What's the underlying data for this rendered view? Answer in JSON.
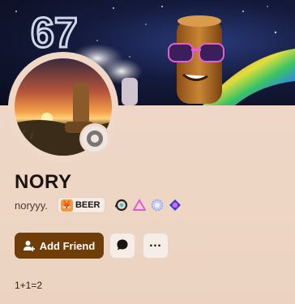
{
  "profile": {
    "display_name": "NORY",
    "username": "noryyy.",
    "bio": "1+1=2",
    "clan_tag": "BEER",
    "status": "offline"
  },
  "banner": {
    "art_text": "67"
  },
  "badges": [
    {
      "icon": "hypesquad-balance-badge-icon"
    },
    {
      "icon": "triangle-badge-icon"
    },
    {
      "icon": "quest-badge-icon"
    },
    {
      "icon": "orb-badge-icon"
    }
  ],
  "actions": {
    "add_friend_label": "Add Friend",
    "message_icon": "chat-bubble-icon",
    "more_icon": "ellipsis-icon"
  },
  "colors": {
    "accent_button": "#6e3d08",
    "card_background": "#efd8c8"
  }
}
